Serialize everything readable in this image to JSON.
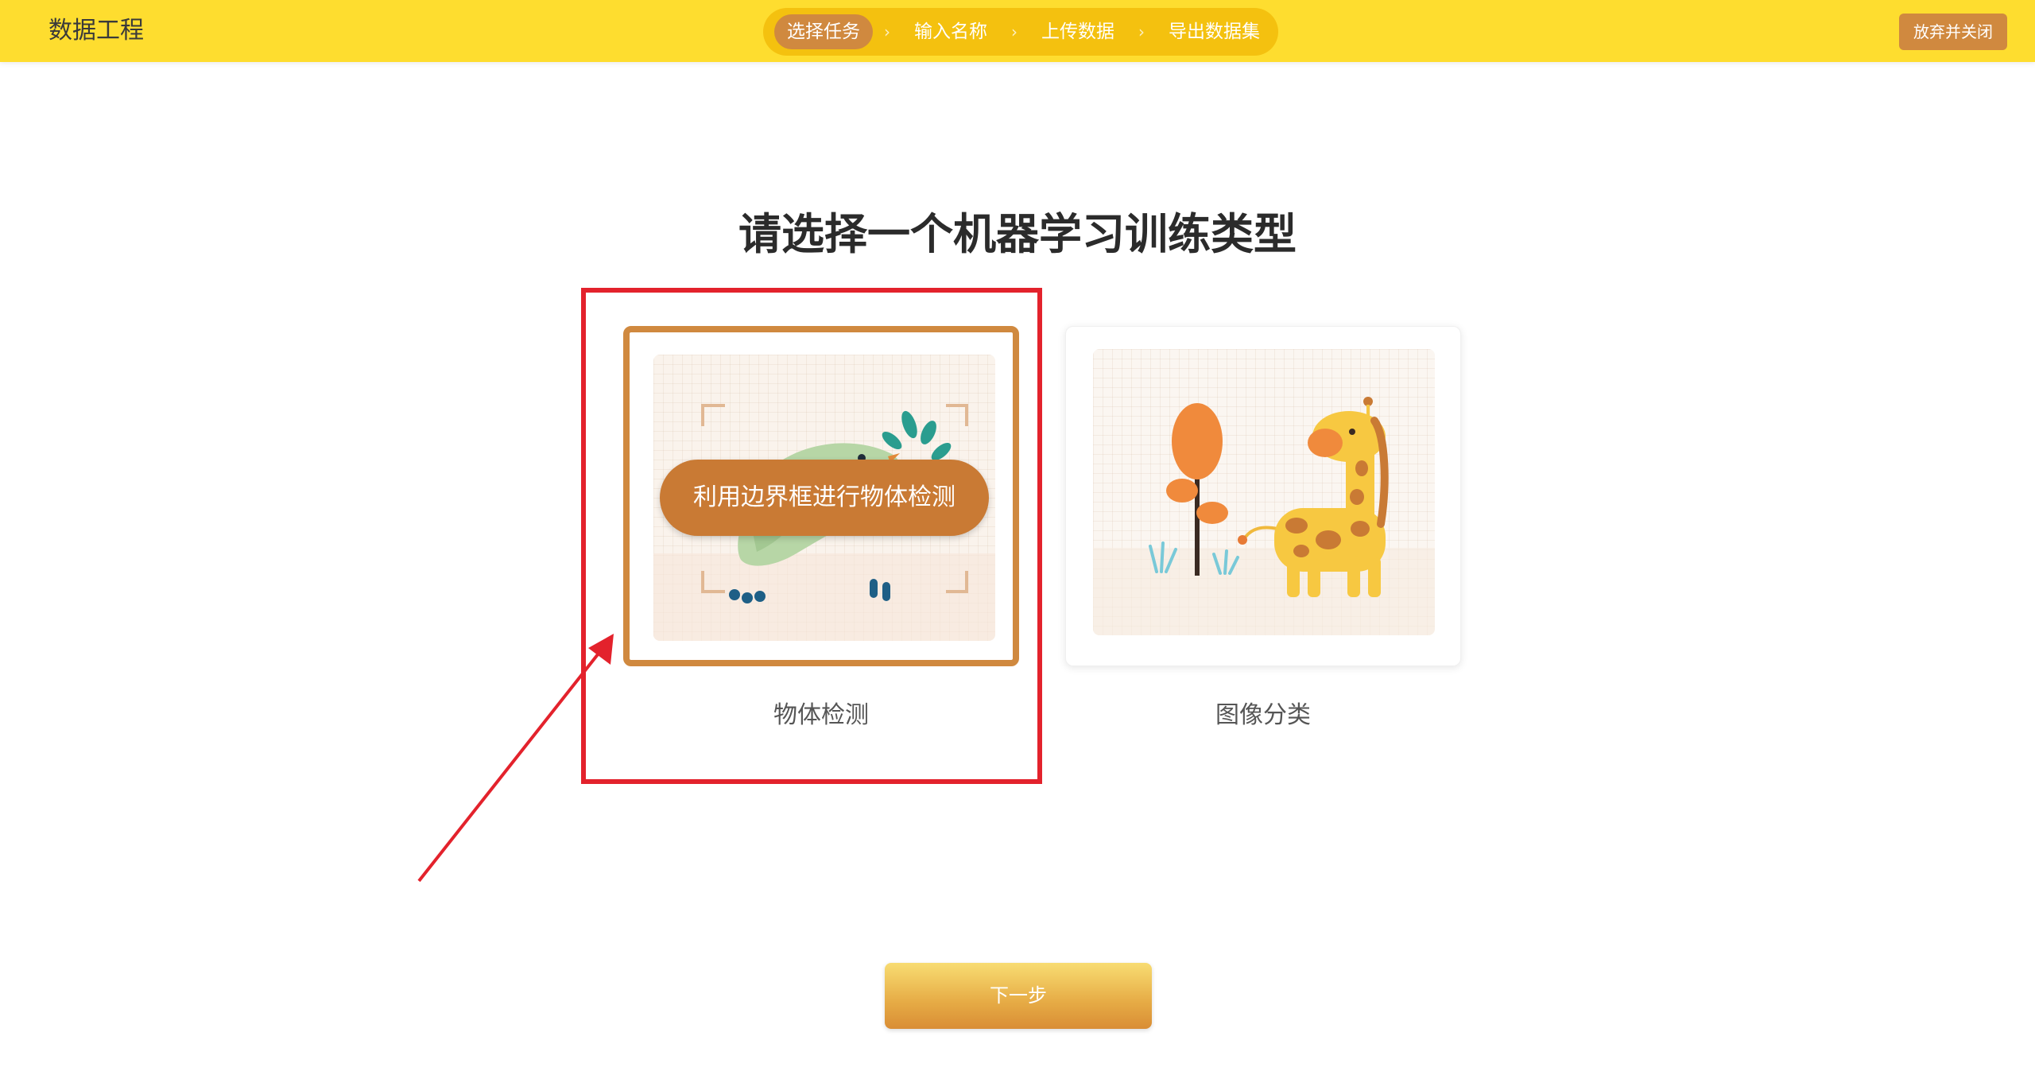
{
  "app": {
    "title": "数据工程"
  },
  "stepper": {
    "steps": [
      {
        "label": "选择任务",
        "active": true
      },
      {
        "label": "输入名称",
        "active": false
      },
      {
        "label": "上传数据",
        "active": false
      },
      {
        "label": "导出数据集",
        "active": false
      }
    ],
    "separator_icon": "chevron-right-icon"
  },
  "header_actions": {
    "close_label": "放弃并关闭"
  },
  "main": {
    "heading": "请选择一个机器学习训练类型",
    "cards": [
      {
        "label": "物体检测",
        "hover_text": "利用边界框进行物体检测",
        "selected": true,
        "illustration": "bird-with-branch-illustration"
      },
      {
        "label": "图像分类",
        "selected": false,
        "illustration": "giraffe-and-tree-illustration"
      }
    ],
    "next_label": "下一步"
  },
  "colors": {
    "topbar": "#fedd2f",
    "stepper_track": "#f4c10f",
    "accent": "#d0893f",
    "annotation": "#e3222c"
  }
}
